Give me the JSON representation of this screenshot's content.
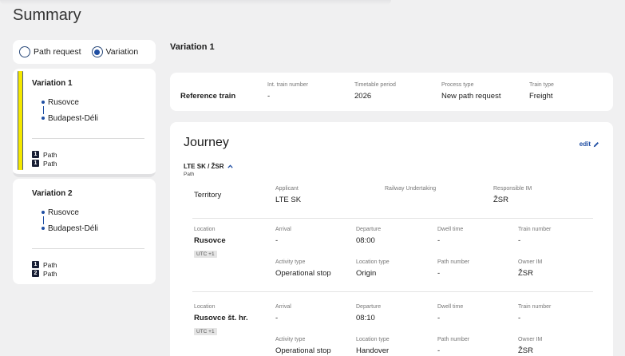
{
  "page": {
    "title": "Summary"
  },
  "toggle": {
    "option1": "Path request",
    "option2": "Variation",
    "selected": "Variation"
  },
  "variations": [
    {
      "title": "Variation 1",
      "from": "Rusovce",
      "to": "Budapest-Déli",
      "counts": [
        {
          "n": "1",
          "label": "Path"
        },
        {
          "n": "1",
          "label": "Path"
        }
      ]
    },
    {
      "title": "Variation 2",
      "from": "Rusovce",
      "to": "Budapest-Déli",
      "counts": [
        {
          "n": "1",
          "label": "Path"
        },
        {
          "n": "2",
          "label": "Path"
        }
      ]
    }
  ],
  "main": {
    "section_title": "Variation 1",
    "reference": {
      "label": "Reference train",
      "fields": [
        {
          "k": "Int. train number",
          "v": "-"
        },
        {
          "k": "Timetable period",
          "v": "2026"
        },
        {
          "k": "Process type",
          "v": "New path request"
        },
        {
          "k": "Train type",
          "v": "Freight"
        }
      ]
    },
    "journey": {
      "title": "Journey",
      "edit": "edit",
      "path_selector": "LTE SK / ŽSR",
      "path_sub": "Path",
      "territory": {
        "label": "Territory",
        "fields": [
          {
            "k": "Applicant",
            "v": "LTE SK"
          },
          {
            "k": "Railway Undertaking",
            "v": ""
          },
          {
            "k": "Responsible IM",
            "v": "ŽSR"
          }
        ]
      },
      "locations": [
        {
          "k": "Location",
          "name": "Rusovce",
          "utc": "UTC +1",
          "row1": [
            {
              "k": "Arrival",
              "v": "-"
            },
            {
              "k": "Departure",
              "v": "08:00"
            },
            {
              "k": "Dwell time",
              "v": "-"
            },
            {
              "k": "Train number",
              "v": "-"
            }
          ],
          "row2": [
            {
              "k": "Activity type",
              "v": "Operational stop"
            },
            {
              "k": "Location type",
              "v": "Origin"
            },
            {
              "k": "Path number",
              "v": "-"
            },
            {
              "k": "Owner IM",
              "v": "ŽSR"
            }
          ]
        },
        {
          "k": "Location",
          "name": "Rusovce št. hr.",
          "utc": "UTC +1",
          "row1": [
            {
              "k": "Arrival",
              "v": "-"
            },
            {
              "k": "Departure",
              "v": "08:10"
            },
            {
              "k": "Dwell time",
              "v": "-"
            },
            {
              "k": "Train number",
              "v": "-"
            }
          ],
          "row2": [
            {
              "k": "Activity type",
              "v": "Operational stop"
            },
            {
              "k": "Location type",
              "v": "Handover"
            },
            {
              "k": "Path number",
              "v": "-"
            },
            {
              "k": "Owner IM",
              "v": "ŽSR"
            }
          ]
        }
      ]
    }
  }
}
